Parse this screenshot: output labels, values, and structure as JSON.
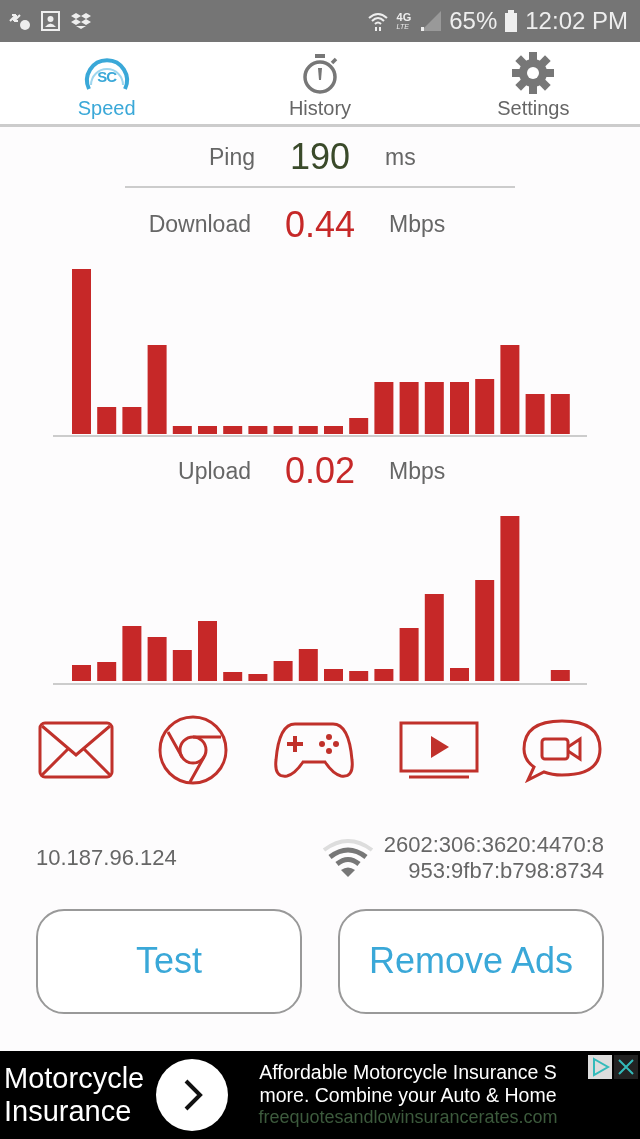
{
  "status_bar": {
    "network": "4G",
    "network_sub": "LTE",
    "battery": "65%",
    "time": "12:02 PM"
  },
  "tabs": [
    {
      "kind": "speed",
      "label": "Speed",
      "logo_text": "SC",
      "selected": true
    },
    {
      "kind": "history",
      "label": "History",
      "selected": false
    },
    {
      "kind": "settings",
      "label": "Settings",
      "selected": false
    }
  ],
  "ping": {
    "label": "Ping",
    "value": "190",
    "unit": "ms"
  },
  "download": {
    "label": "Download",
    "value": "0.44",
    "unit": "Mbps"
  },
  "upload": {
    "label": "Upload",
    "value": "0.02",
    "unit": "Mbps"
  },
  "addresses": {
    "ipv4": "10.187.96.124",
    "ipv6_lines": [
      "2602:306:3620:4470:8",
      "953:9fb7:b798:8734"
    ]
  },
  "buttons": [
    "Test",
    "Remove Ads"
  ],
  "ad": {
    "headline_lines": [
      "Motorcycle",
      "Insurance"
    ],
    "body_lines": [
      "Affordable Motorcycle Insurance S",
      "more. Combine your Auto & Home"
    ],
    "url": "freequotesandlowinsurancerates.com"
  }
}
